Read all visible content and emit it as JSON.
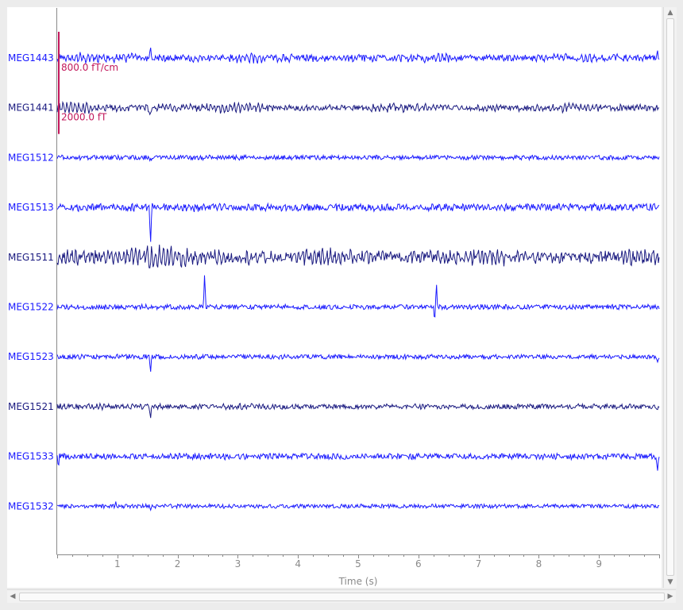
{
  "chart_data": {
    "type": "line",
    "title": "",
    "xlabel": "Time (s)",
    "ylabel": "",
    "xlim": [
      0,
      10
    ],
    "x_ticks": [
      "1",
      "2",
      "3",
      "4",
      "5",
      "6",
      "7",
      "8",
      "9"
    ],
    "grid": false,
    "channels": [
      {
        "name": "MEG1443",
        "kind": "grad",
        "amp": 4.0,
        "osc": 1.0,
        "events": [
          {
            "t": 1.55,
            "a": -13
          },
          {
            "t": 9.97,
            "a": -14
          }
        ]
      },
      {
        "name": "MEG1441",
        "kind": "mag",
        "amp": 3.5,
        "osc": 1.3,
        "events": [
          {
            "t": 1.55,
            "a": 12
          }
        ]
      },
      {
        "name": "MEG1512",
        "kind": "grad",
        "amp": 2.8,
        "osc": 0.2,
        "events": [
          {
            "t": 1.55,
            "a": 4
          }
        ]
      },
      {
        "name": "MEG1513",
        "kind": "grad",
        "amp": 4.5,
        "osc": 0.3,
        "events": [
          {
            "t": 1.55,
            "a": 44
          }
        ]
      },
      {
        "name": "MEG1511",
        "kind": "mag",
        "amp": 6.5,
        "osc": 1.5,
        "events": [
          {
            "t": 1.55,
            "a": 6
          }
        ]
      },
      {
        "name": "MEG1522",
        "kind": "grad",
        "amp": 3.0,
        "osc": 0.2,
        "events": [
          {
            "t": 2.45,
            "a": -48
          },
          {
            "t": 6.3,
            "a": -32
          },
          {
            "t": 6.27,
            "a": 22
          }
        ]
      },
      {
        "name": "MEG1523",
        "kind": "grad",
        "amp": 2.8,
        "osc": 0.2,
        "events": [
          {
            "t": 1.55,
            "a": 20
          },
          {
            "t": 9.97,
            "a": 10
          }
        ]
      },
      {
        "name": "MEG1521",
        "kind": "mag",
        "amp": 3.0,
        "osc": 0.5,
        "events": [
          {
            "t": 1.55,
            "a": 15
          },
          {
            "t": 9.97,
            "a": 8
          }
        ]
      },
      {
        "name": "MEG1533",
        "kind": "grad",
        "amp": 3.5,
        "osc": 0.3,
        "events": [
          {
            "t": 9.97,
            "a": 18
          },
          {
            "t": 0.02,
            "a": 18
          }
        ]
      },
      {
        "name": "MEG1532",
        "kind": "grad",
        "amp": 2.5,
        "osc": 0.2,
        "events": [
          {
            "t": 0.97,
            "a": -6
          },
          {
            "t": 1.55,
            "a": 6
          }
        ]
      }
    ],
    "scalebars": [
      {
        "label": "800.0 fT/cm",
        "channel": "MEG1443"
      },
      {
        "label": "2000.0 fT",
        "channel": "MEG1441"
      }
    ]
  },
  "colors": {
    "grad": "#1a1aff",
    "mag": "#1a1a80",
    "scalebar": "#c2185b",
    "axis": "#8a8a8a",
    "label_grad": "#1a1aff",
    "label_mag": "#1a1a80"
  },
  "icons": {
    "scroll_up": "▲",
    "scroll_down": "▼",
    "scroll_left": "◀",
    "scroll_right": "▶"
  }
}
